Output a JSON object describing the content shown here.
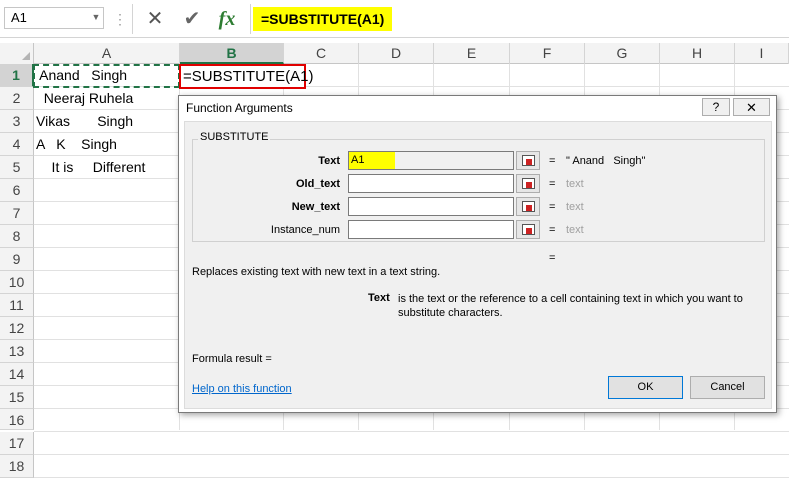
{
  "formula_bar": {
    "name_box": "A1",
    "name_box_arrow": "▼",
    "dots": "⋮",
    "cancel_glyph": "✕",
    "enter_glyph": "✔",
    "fx_glyph": "fx",
    "formula": "=SUBSTITUTE(A1)",
    "highlight_color": "#ffff00"
  },
  "columns": [
    "A",
    "B",
    "C",
    "D",
    "E",
    "F",
    "G",
    "H",
    "I"
  ],
  "active_column": "B",
  "rows": [
    "1",
    "2",
    "3",
    "4",
    "5",
    "6",
    "7",
    "8",
    "9",
    "10",
    "11",
    "12",
    "13",
    "14",
    "15",
    "16",
    "17",
    "18"
  ],
  "active_row": "1",
  "cells_a": [
    " Anand   Singh",
    "  Neeraj Ruhela",
    "Vikas       Singh",
    "A   K    Singh",
    "    It is     Different"
  ],
  "b1_editing": "=SUBSTITUTE(A1)",
  "dialog": {
    "title": "Function Arguments",
    "help_label": "?",
    "close_label": "✕",
    "function_name": "SUBSTITUTE",
    "args": [
      {
        "label": "Text",
        "value": "A1",
        "result": "\" Anand   Singh\""
      },
      {
        "label": "Old_text",
        "value": "",
        "result": "text"
      },
      {
        "label": "New_text",
        "value": "",
        "result": "text"
      },
      {
        "label": "Instance_num",
        "value": "",
        "result": "text"
      }
    ],
    "equals": "=",
    "result_equals": "=",
    "description": "Replaces existing text with new text in a text string.",
    "arg_desc_name": "Text",
    "arg_desc_text": "is the text or the reference to a cell containing text in which you want to substitute characters.",
    "formula_result": "Formula result =",
    "help_link": "Help on this function",
    "ok_label": "OK",
    "cancel_label": "Cancel"
  },
  "colors": {
    "excel_green": "#217346",
    "edit_border": "#e00000",
    "link": "#0066cc",
    "ok_border": "#0078d7"
  }
}
